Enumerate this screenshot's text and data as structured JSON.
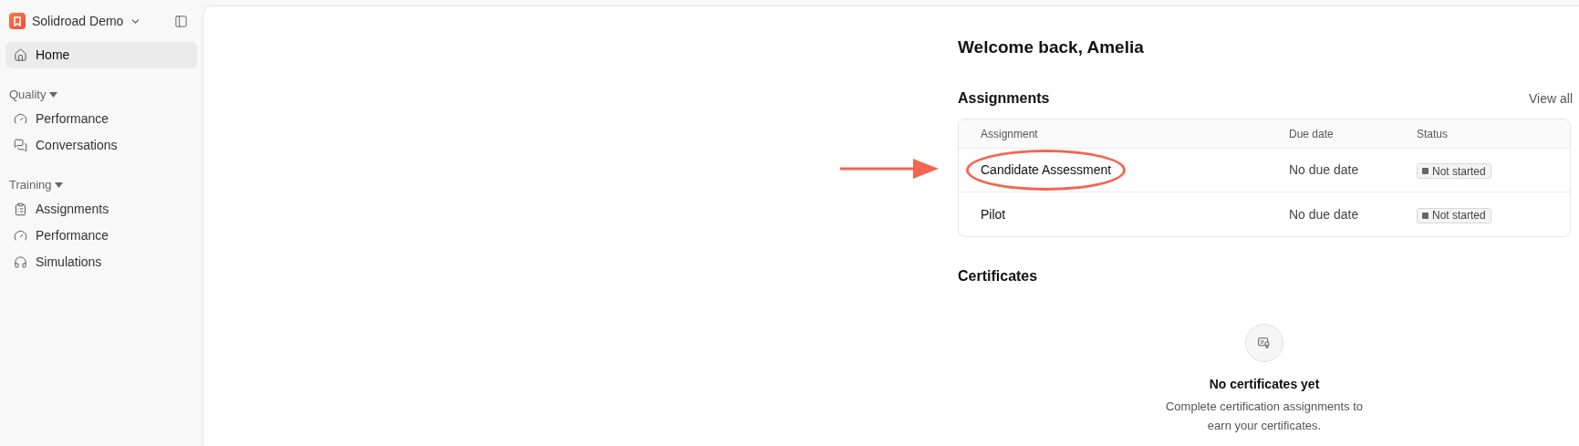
{
  "workspace": {
    "name": "Solidroad Demo"
  },
  "sidebar": {
    "items": [
      {
        "label": "Home",
        "selected": true
      }
    ],
    "groups": [
      {
        "label": "Quality",
        "expanded": true,
        "items": [
          {
            "label": "Performance",
            "selected": false
          },
          {
            "label": "Conversations",
            "selected": false
          }
        ]
      },
      {
        "label": "Training",
        "expanded": true,
        "items": [
          {
            "label": "Assignments",
            "selected": false
          },
          {
            "label": "Performance",
            "selected": false
          },
          {
            "label": "Simulations",
            "selected": false
          }
        ]
      }
    ]
  },
  "main": {
    "title": "Welcome back, Amelia",
    "assignments": {
      "heading": "Assignments",
      "view_all": "View all",
      "columns": [
        "Assignment",
        "Due date",
        "Status"
      ],
      "rows": [
        {
          "name": "Candidate Assessment",
          "due": "No due date",
          "status": "Not started",
          "highlighted": true
        },
        {
          "name": "Pilot",
          "due": "No due date",
          "status": "Not started",
          "highlighted": false
        }
      ]
    },
    "certificates": {
      "heading": "Certificates",
      "empty_title": "No certificates yet",
      "empty_text": "Complete certification assignments to earn your certificates."
    }
  }
}
